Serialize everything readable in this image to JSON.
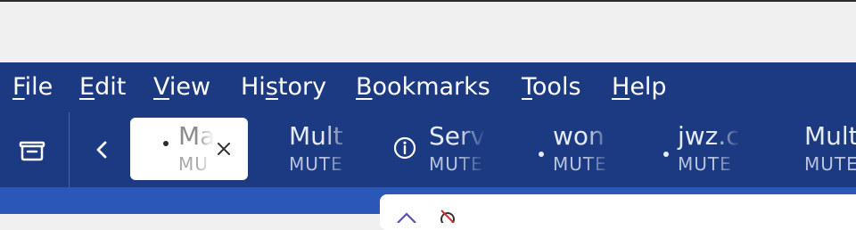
{
  "menubar": {
    "items": [
      {
        "label": "File",
        "accel": "F",
        "rest": "ile"
      },
      {
        "label": "Edit",
        "accel": "E",
        "rest": "dit"
      },
      {
        "label": "View",
        "accel": "V",
        "rest": "iew"
      },
      {
        "label": "History",
        "pre": "Hi",
        "accel": "s",
        "rest": "tory"
      },
      {
        "label": "Bookmarks",
        "accel": "B",
        "rest": "ookmarks"
      },
      {
        "label": "Tools",
        "accel": "T",
        "rest": "ools"
      },
      {
        "label": "Help",
        "accel": "H",
        "rest": "elp"
      }
    ]
  },
  "tabs": [
    {
      "title": "Ma",
      "sub": "MU",
      "active": true
    },
    {
      "title": "Mult",
      "sub": "MUTE"
    },
    {
      "title": "Serv",
      "sub": "MUTE"
    },
    {
      "title": "won",
      "sub": "MUTE"
    },
    {
      "title": "jwz.c",
      "sub": "MUTE"
    },
    {
      "title": "Mult",
      "sub": "MUTE"
    }
  ],
  "icons": {
    "tab_list": "tab-list-icon",
    "back": "chevron-left-icon",
    "close": "close-icon",
    "info": "info-icon"
  },
  "colors": {
    "toolbar": "#1c3a82",
    "urlbar_row": "#2a57b8",
    "text": "#ffffff"
  }
}
